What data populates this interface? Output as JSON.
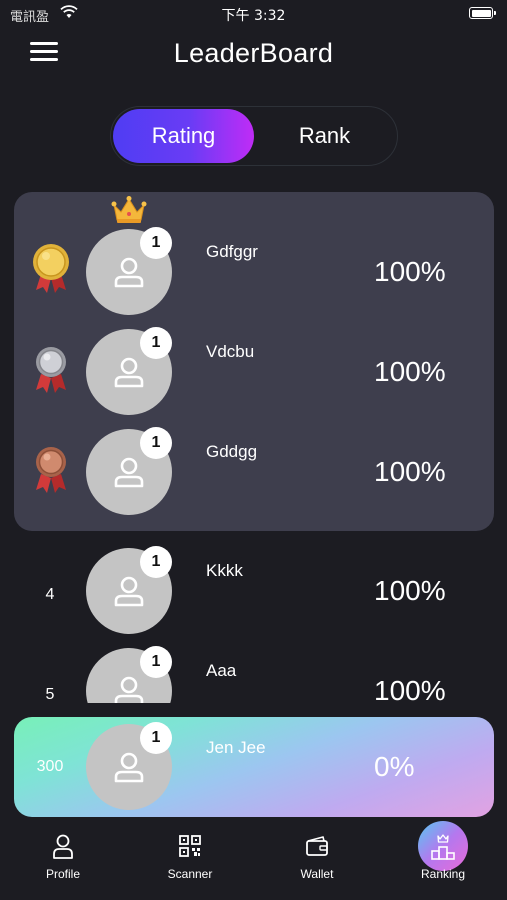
{
  "status_bar": {
    "carrier": "電訊盈",
    "time": "下午 3:32"
  },
  "header": {
    "title": "LeaderBoard"
  },
  "segmented": {
    "options": [
      "Rating",
      "Rank"
    ],
    "selected": "Rating"
  },
  "players": [
    {
      "rank": "1",
      "medal": "gold-medal-icon",
      "name": "Gdfggr",
      "level": "1",
      "score": "100%"
    },
    {
      "rank": "2",
      "medal": "silver-medal-icon",
      "name": "Vdcbu",
      "level": "1",
      "score": "100%"
    },
    {
      "rank": "3",
      "medal": "bronze-medal-icon",
      "name": "Gddgg",
      "level": "1",
      "score": "100%"
    },
    {
      "rank": "4",
      "name": "Kkkk",
      "level": "1",
      "score": "100%"
    },
    {
      "rank": "5",
      "name": "Aaa",
      "level": "1",
      "score": "100%"
    }
  ],
  "current_user": {
    "rank": "300",
    "name": "Jen Jee",
    "level": "1",
    "score": "0%"
  },
  "tabs": [
    {
      "label": "Profile",
      "icon": "person-icon"
    },
    {
      "label": "Scanner",
      "icon": "qr-code-icon"
    },
    {
      "label": "Wallet",
      "icon": "wallet-icon"
    },
    {
      "label": "Ranking",
      "icon": "podium-icon",
      "active": true
    }
  ],
  "colors": {
    "background": "#1c1c22",
    "podium_card": "#3e3e4d",
    "accent_start": "#4f3df3",
    "accent_end": "#c02cf6",
    "avatar": "#c4c4c4"
  }
}
